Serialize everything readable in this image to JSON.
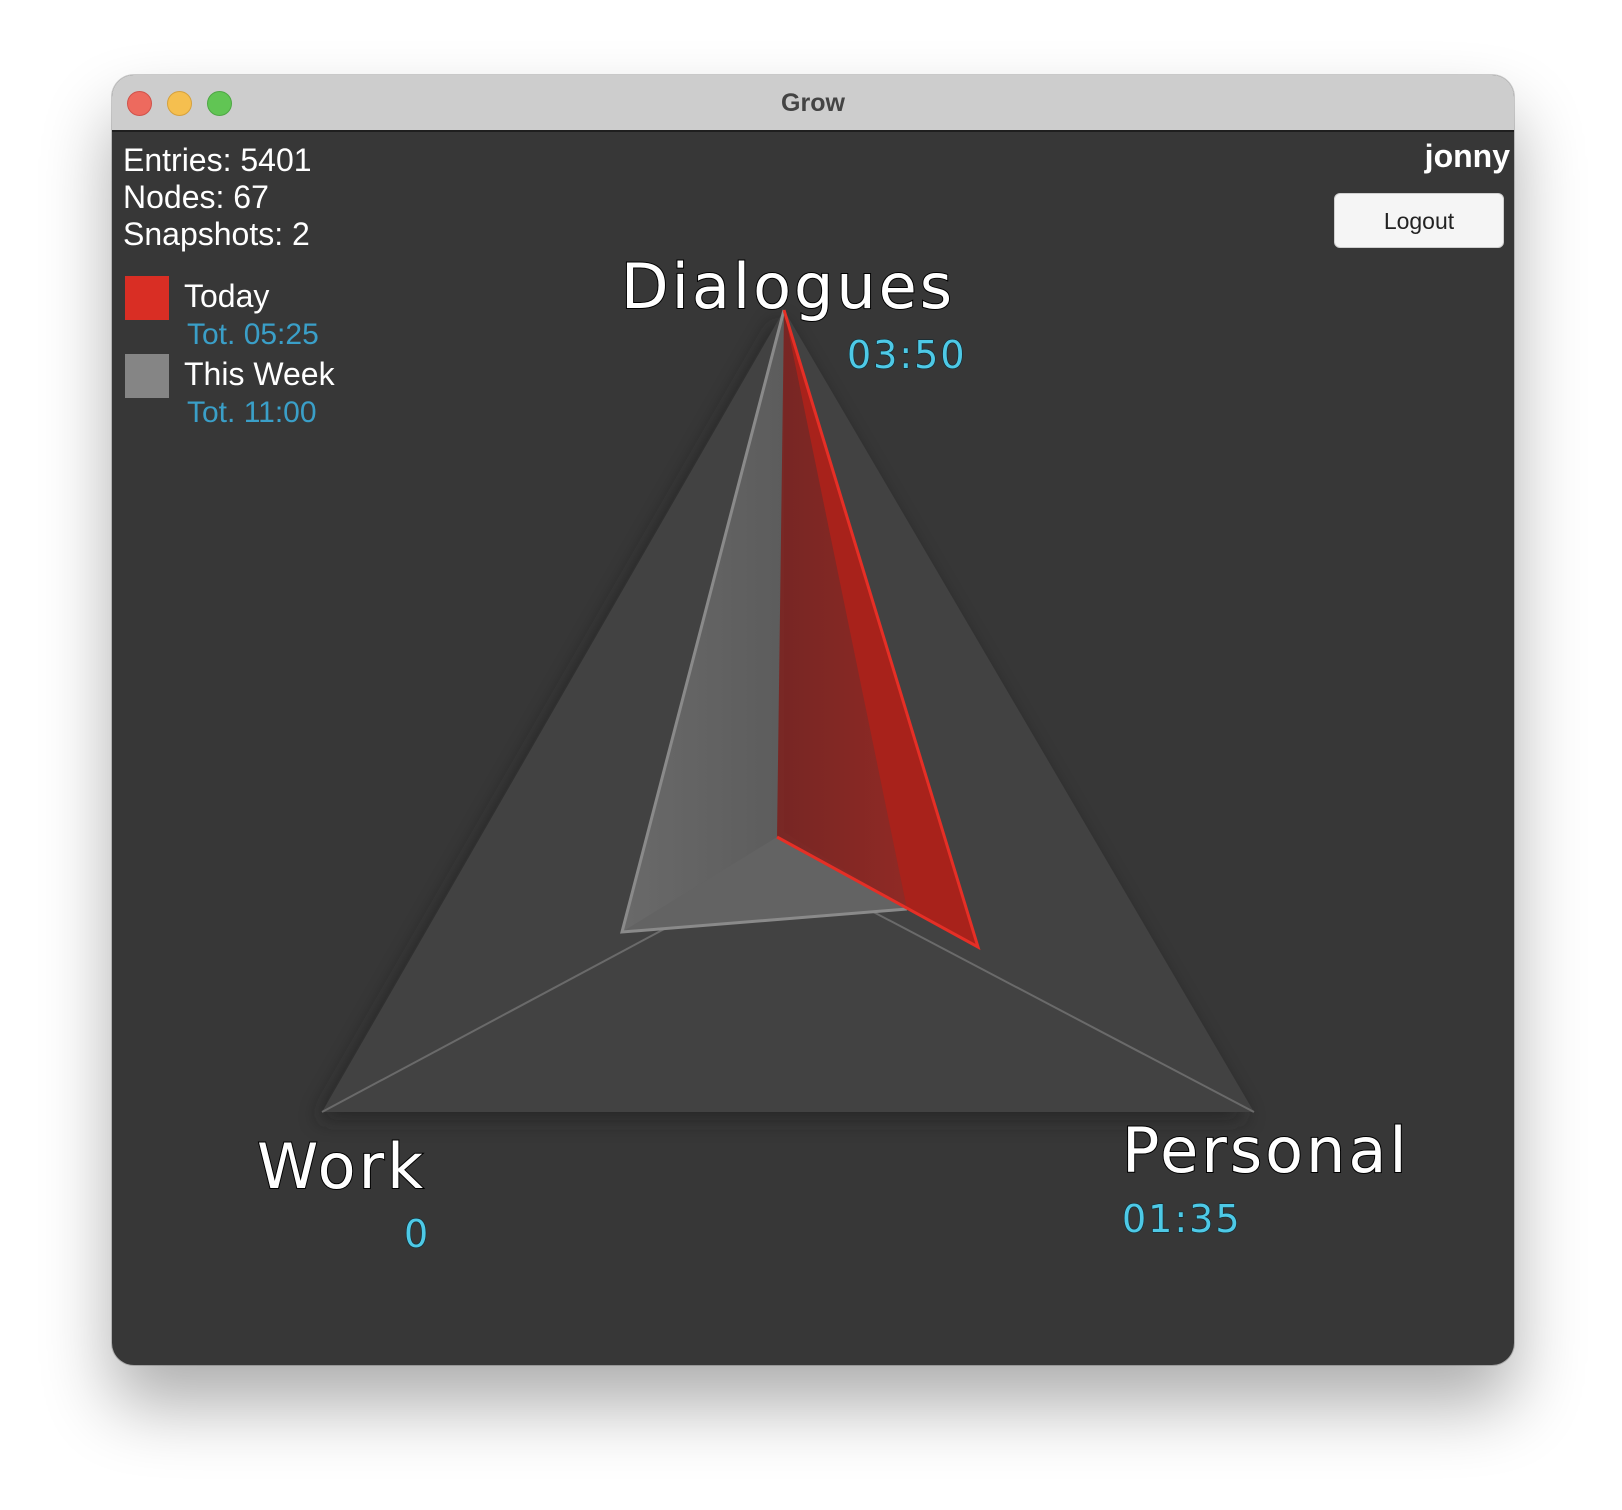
{
  "window": {
    "title": "Grow"
  },
  "stats": {
    "entries": "Entries: 5401",
    "nodes": "Nodes: 67",
    "snapshots": "Snapshots: 2"
  },
  "legend": [
    {
      "label": "Today",
      "total": "Tot. 05:25",
      "color": "#d92e24"
    },
    {
      "label": "This Week",
      "total": "Tot. 11:00",
      "color": "#858585"
    }
  ],
  "user": {
    "name": "jonny",
    "logout_label": "Logout"
  },
  "chart_data": {
    "type": "radar",
    "categories": [
      "Dialogues",
      "Personal",
      "Work"
    ],
    "value_labels": [
      "03:50",
      "01:35",
      "0"
    ],
    "series": [
      {
        "name": "Today",
        "values_minutes": [
          230,
          95,
          0
        ],
        "color": "#d92e24"
      },
      {
        "name": "This Week",
        "values_fraction": [
          1.0,
          0.26,
          0.32
        ],
        "color": "#858585"
      }
    ]
  }
}
